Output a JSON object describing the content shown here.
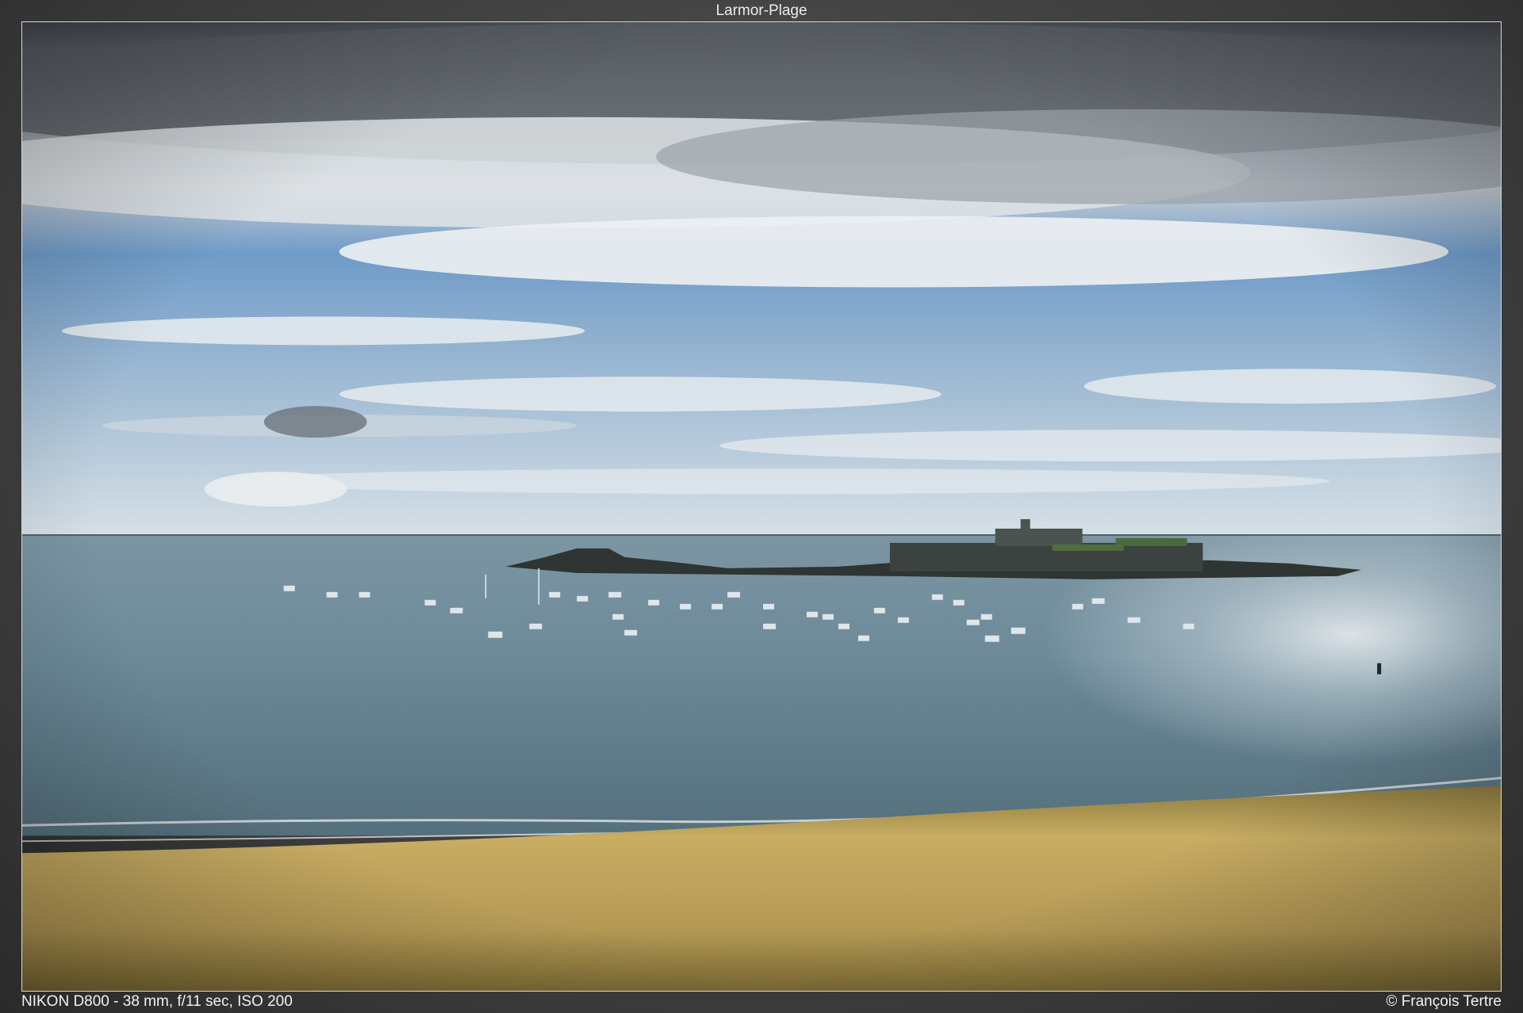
{
  "title": "Larmor-Plage",
  "exif": "NIKON D800 - 38 mm, f/11 sec, ISO 200",
  "credit": "© François Tertre",
  "colors": {
    "sky_blue": "#5e8fc0",
    "cloud": "#e8ecef",
    "sea": "#5f7d8e",
    "sand": "#b69a55",
    "frame": "#3c3c3c"
  }
}
